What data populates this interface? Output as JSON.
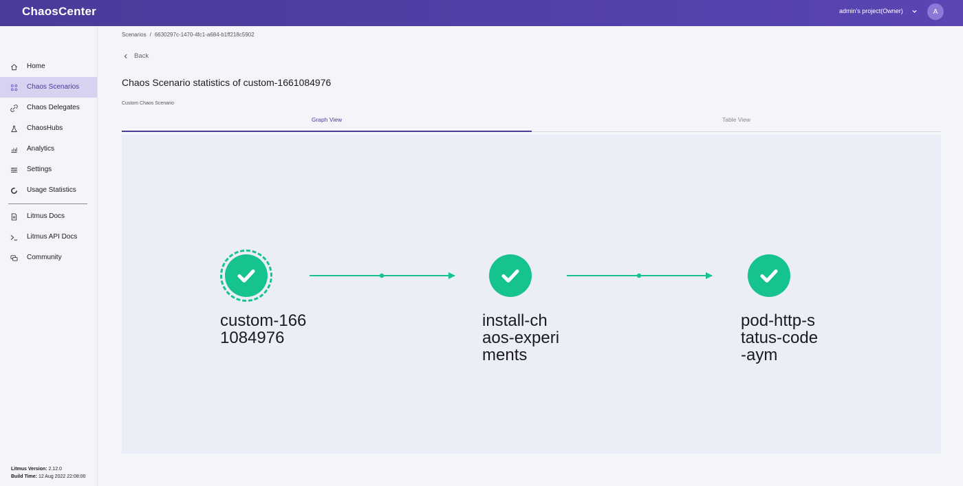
{
  "app": {
    "title": "ChaosCenter"
  },
  "header": {
    "project_label": "admin's project(Owner)",
    "avatar_initial": "A"
  },
  "sidebar": {
    "items": [
      {
        "label": "Home",
        "icon": "home-icon",
        "active": false
      },
      {
        "label": "Chaos Scenarios",
        "icon": "scenarios-icon",
        "active": true
      },
      {
        "label": "Chaos Delegates",
        "icon": "link-icon",
        "active": false
      },
      {
        "label": "ChaosHubs",
        "icon": "flask-icon",
        "active": false
      },
      {
        "label": "Analytics",
        "icon": "analytics-icon",
        "active": false
      },
      {
        "label": "Settings",
        "icon": "settings-icon",
        "active": false
      },
      {
        "label": "Usage Statistics",
        "icon": "usage-icon",
        "active": false
      },
      {
        "label": "Litmus Docs",
        "icon": "document-icon",
        "active": false
      },
      {
        "label": "Litmus API Docs",
        "icon": "terminal-icon",
        "active": false
      },
      {
        "label": "Community",
        "icon": "community-icon",
        "active": false
      }
    ],
    "version_label": "Litmus Version:",
    "version_value": "2.12.0",
    "build_label": "Build Time:",
    "build_value": "12 Aug 2022 22:08:00"
  },
  "breadcrumb": {
    "root": "Scenarios",
    "separator": "/",
    "current": "6630297c-1470-4fc1-a684-b1ff218c5902"
  },
  "back_label": "Back",
  "page": {
    "title": "Chaos Scenario statistics of custom-1661084976",
    "subtitle": "Custom Chaos Scenario"
  },
  "tabs": [
    {
      "label": "Graph View",
      "active": true
    },
    {
      "label": "Table View",
      "active": false
    }
  ],
  "graph": {
    "nodes": [
      {
        "label": "custom-166\n1084976",
        "status": "succeeded",
        "selected": true
      },
      {
        "label": "install-ch\naos-experi\nments",
        "status": "succeeded",
        "selected": false
      },
      {
        "label": "pod-http-s\ntatus-code\n-aym",
        "status": "succeeded",
        "selected": false
      }
    ],
    "success_color": "#16c28d"
  },
  "colors": {
    "accent": "#4a3a99",
    "success": "#16c28d",
    "topbar": "#5340a8"
  }
}
